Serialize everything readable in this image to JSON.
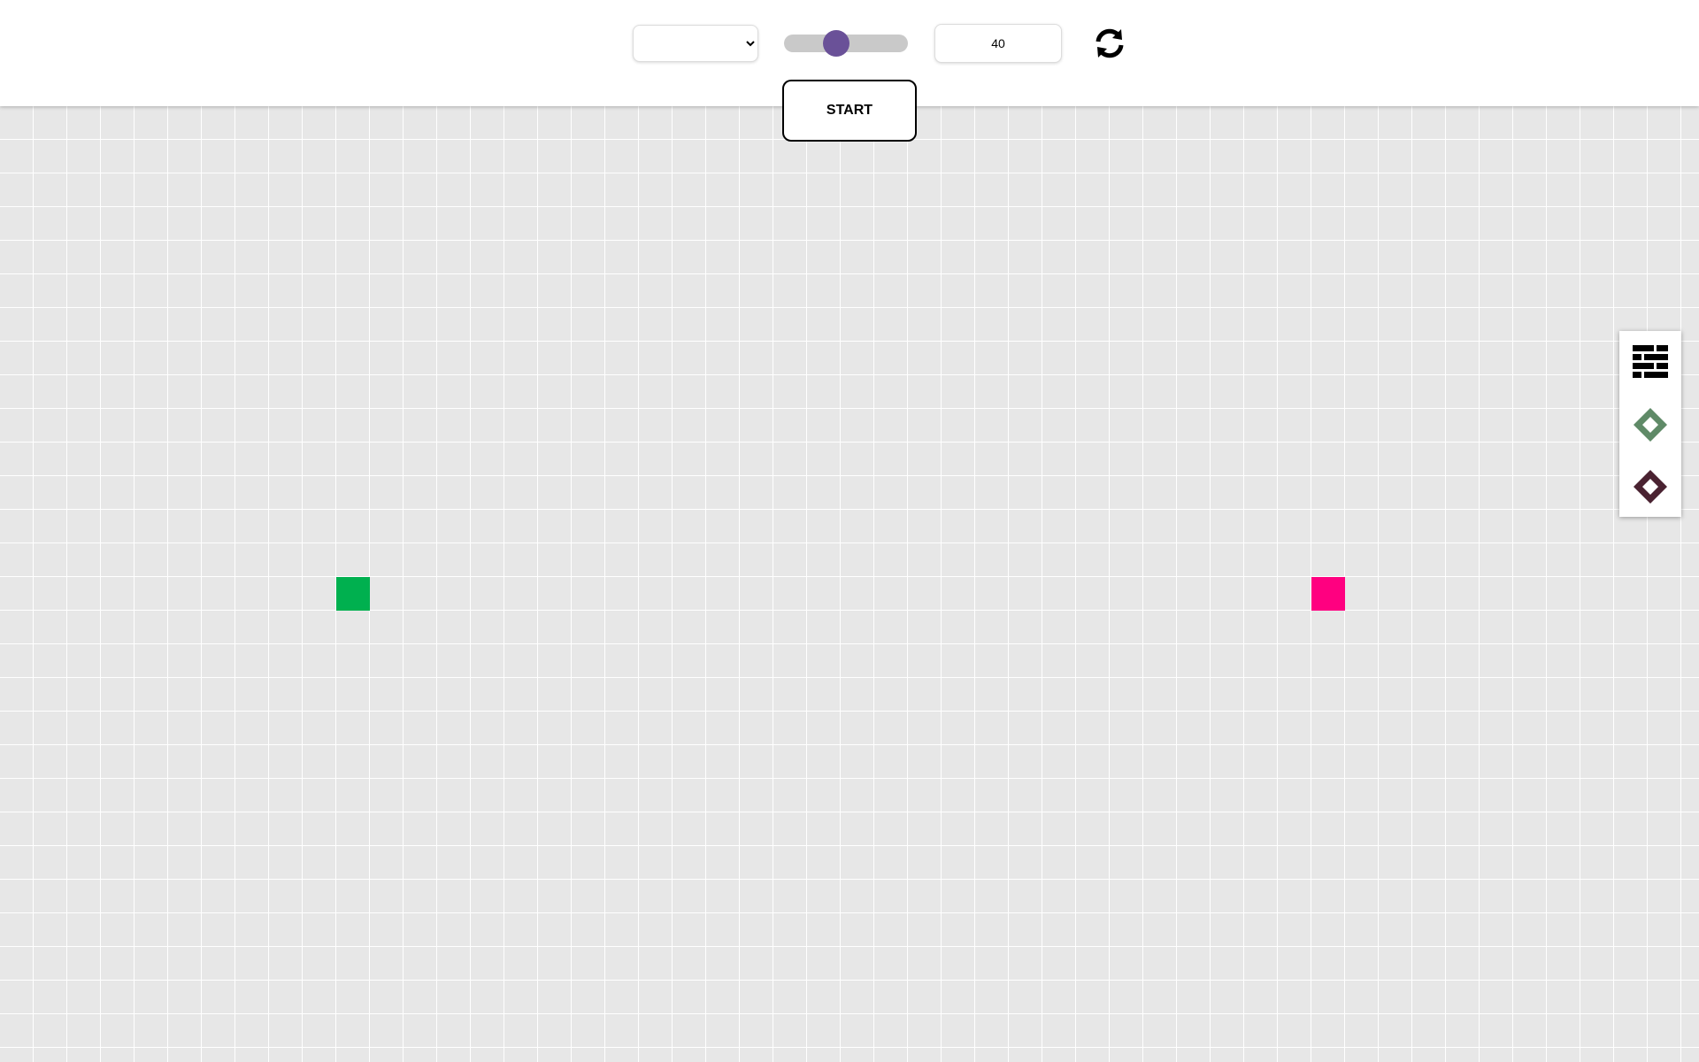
{
  "toolbar": {
    "algorithm_select": {
      "selected_label": "",
      "options": [
        ""
      ]
    },
    "speed_slider": {
      "value_fraction": 0.42
    },
    "grid_size_input": {
      "value": "40"
    },
    "refresh_icon": "refresh-icon",
    "start_label": "START"
  },
  "grid": {
    "start_node_color": "#00b04f",
    "end_node_color": "#ff0080",
    "cell_color": "#e7e7e7",
    "line_color": "#ffffff"
  },
  "tools": {
    "items": [
      {
        "name": "wall-tool",
        "icon": "brick-wall-icon",
        "color": "#000000"
      },
      {
        "name": "start-node-tool",
        "icon": "diamond-icon",
        "color": "#5f8a67"
      },
      {
        "name": "end-node-tool",
        "icon": "diamond-icon",
        "color": "#4a2231"
      }
    ]
  },
  "colors": {
    "accent": "#6a5198",
    "slider_track": "#c9c9c9"
  }
}
